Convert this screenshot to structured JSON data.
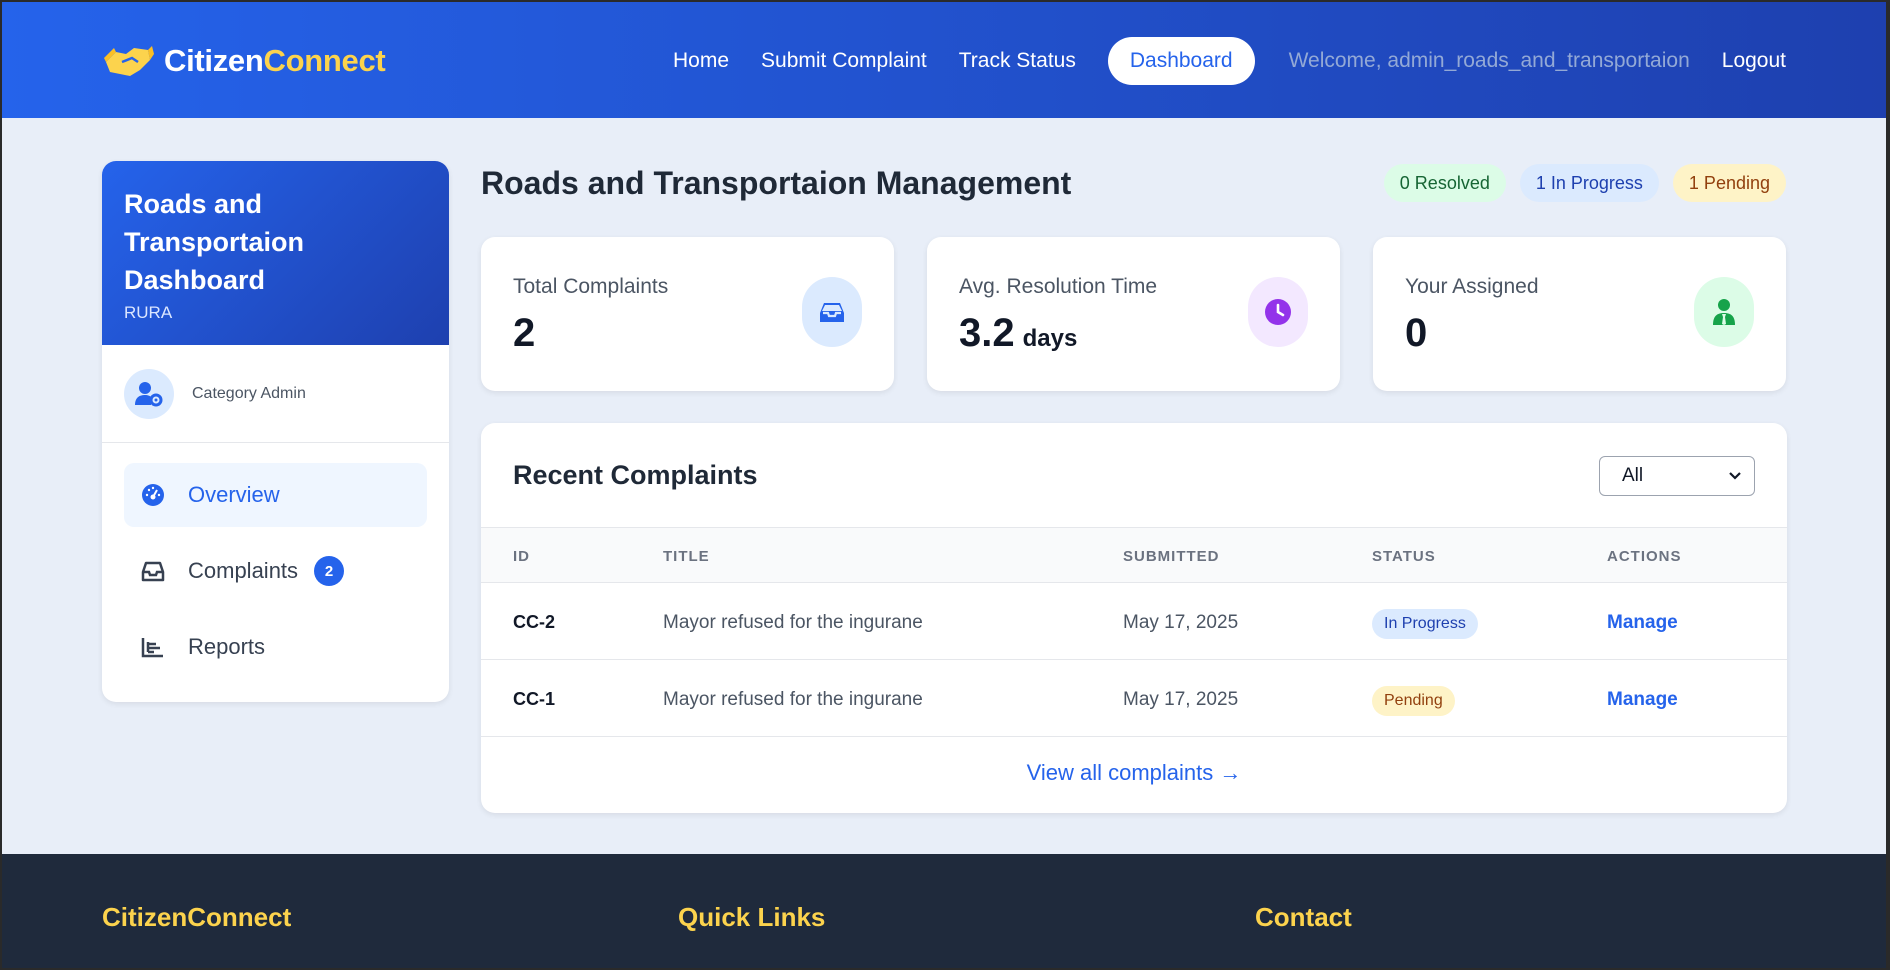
{
  "navbar": {
    "brand_primary": "Citizen",
    "brand_accent": "Connect",
    "links": {
      "home": "Home",
      "submit": "Submit Complaint",
      "track": "Track Status",
      "dashboard": "Dashboard"
    },
    "welcome": "Welcome, admin_roads_and_transportaion",
    "logout": "Logout"
  },
  "sidebar": {
    "title": "Roads and Transportaion Dashboard",
    "org": "RURA",
    "role": "Category Admin",
    "items": [
      {
        "label": "Overview",
        "icon": "gauge-icon",
        "active": true
      },
      {
        "label": "Complaints",
        "icon": "inbox-icon",
        "badge": "2"
      },
      {
        "label": "Reports",
        "icon": "chart-icon"
      }
    ]
  },
  "header": {
    "title": "Roads and Transportaion Management",
    "pills": {
      "resolved": "0 Resolved",
      "in_progress": "1 In Progress",
      "pending": "1 Pending"
    }
  },
  "stats": [
    {
      "label": "Total Complaints",
      "value": "2",
      "unit": "",
      "icon": "inbox-icon",
      "icon_bg": "#dbeafe",
      "icon_color": "#2563eb"
    },
    {
      "label": "Avg. Resolution Time",
      "value": "3.2",
      "unit": "days",
      "icon": "clock-icon",
      "icon_bg": "#f3e8ff",
      "icon_color": "#9333ea"
    },
    {
      "label": "Your Assigned",
      "value": "0",
      "unit": "",
      "icon": "user-tie-icon",
      "icon_bg": "#dcfce7",
      "icon_color": "#16a34a"
    }
  ],
  "recent": {
    "title": "Recent Complaints",
    "filter_value": "All",
    "columns": [
      "ID",
      "TITLE",
      "SUBMITTED",
      "STATUS",
      "ACTIONS"
    ],
    "rows": [
      {
        "id": "CC-2",
        "title": "Mayor refused for the ingurane",
        "submitted": "May 17, 2025",
        "status": "In Progress",
        "status_kind": "progress",
        "action": "Manage"
      },
      {
        "id": "CC-1",
        "title": "Mayor refused for the ingurane",
        "submitted": "May 17, 2025",
        "status": "Pending",
        "status_kind": "pending",
        "action": "Manage"
      }
    ],
    "view_all": "View all complaints →"
  },
  "footer": {
    "col1": "CitizenConnect",
    "col2": "Quick Links",
    "col3": "Contact"
  },
  "colors": {
    "primary": "#2563eb",
    "accent": "#fcd34d",
    "footer_bg": "#1f2a3c"
  }
}
